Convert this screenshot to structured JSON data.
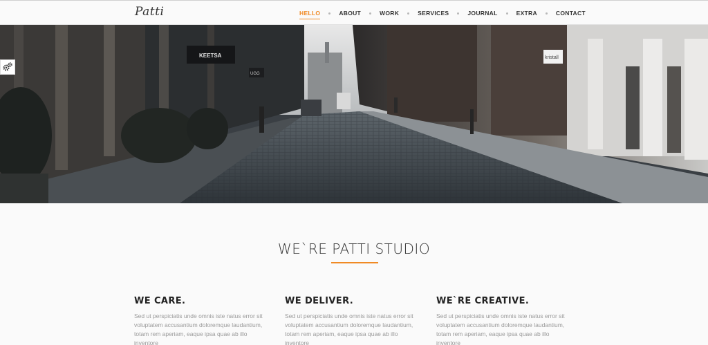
{
  "header": {
    "logo": "Patti",
    "nav": [
      {
        "label": "HELLO",
        "active": true
      },
      {
        "label": "ABOUT",
        "active": false
      },
      {
        "label": "WORK",
        "active": false
      },
      {
        "label": "SERVICES",
        "active": false
      },
      {
        "label": "JOURNAL",
        "active": false
      },
      {
        "label": "EXTRA",
        "active": false
      },
      {
        "label": "CONTACT",
        "active": false
      }
    ]
  },
  "hero": {
    "sign_left": "KEETSA",
    "sign_small": "UGG",
    "sign_right": "kristall"
  },
  "settings": {
    "icon": "gears-icon"
  },
  "intro": {
    "title": "WE`RE PATTI STUDIO"
  },
  "features": [
    {
      "title": "WE CARE.",
      "text": "Sed ut perspiciatis unde omnis iste natus error sit voluptatem accusantium doloremque laudantium, totam rem aperiam, eaque ipsa quae ab illo inventore"
    },
    {
      "title": "WE DELIVER.",
      "text": "Sed ut perspiciatis unde omnis iste natus error sit voluptatem accusantium doloremque laudantium, totam rem aperiam, eaque ipsa quae ab illo inventore"
    },
    {
      "title": "WE`RE CREATIVE.",
      "text": "Sed ut perspiciatis unde omnis iste natus error sit voluptatem accusantium doloremque laudantium, totam rem aperiam, eaque ipsa quae ab illo inventore"
    }
  ],
  "colors": {
    "accent": "#f08a24",
    "text": "#222222",
    "muted": "#999999"
  }
}
